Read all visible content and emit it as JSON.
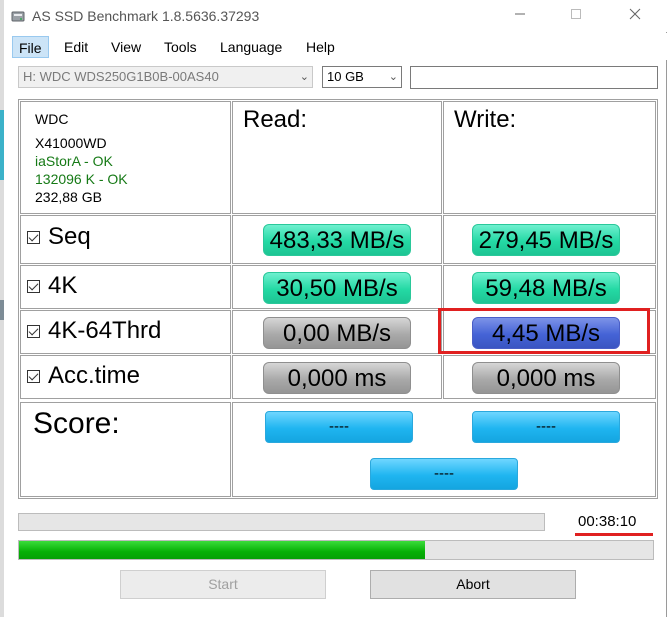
{
  "window": {
    "title": "AS SSD Benchmark 1.8.5636.37293"
  },
  "menu": [
    {
      "label": "File"
    },
    {
      "label": "Edit"
    },
    {
      "label": "View"
    },
    {
      "label": "Tools"
    },
    {
      "label": "Language"
    },
    {
      "label": "Help"
    }
  ],
  "drive_select": {
    "value": "H: WDC WDS250G1B0B-00AS40"
  },
  "size_select": {
    "value": "10 GB"
  },
  "drive_info": {
    "model": "WDC",
    "firmware": "X41000WD",
    "driver_status": "iaStorA - OK",
    "alignment_status": "132096 K - OK",
    "capacity": "232,88 GB"
  },
  "columns": {
    "read": "Read:",
    "write": "Write:"
  },
  "tests": [
    {
      "label": "Seq",
      "read": "483,33 MB/s",
      "write": "279,45 MB/s"
    },
    {
      "label": "4K",
      "read": "30,50 MB/s",
      "write": "59,48 MB/s"
    },
    {
      "label": "4K-64Thrd",
      "read": "0,00 MB/s",
      "write": "4,45 MB/s"
    },
    {
      "label": "Acc.time",
      "read": "0,000 ms",
      "write": "0,000 ms"
    }
  ],
  "score": {
    "label": "Score:",
    "read": "----",
    "write": "----",
    "total": "----"
  },
  "timer": "00:38:10",
  "progress": {
    "percent": 64
  },
  "buttons": {
    "start": "Start",
    "abort": "Abort"
  },
  "colors": {
    "result_green": "#24d9a4",
    "result_gray": "#a9a9a9",
    "result_blue": "#4563d6",
    "score_blue": "#1fb5f0",
    "progress_green": "#06b006",
    "highlight_red": "#e02020",
    "ok_text": "#167a16"
  }
}
